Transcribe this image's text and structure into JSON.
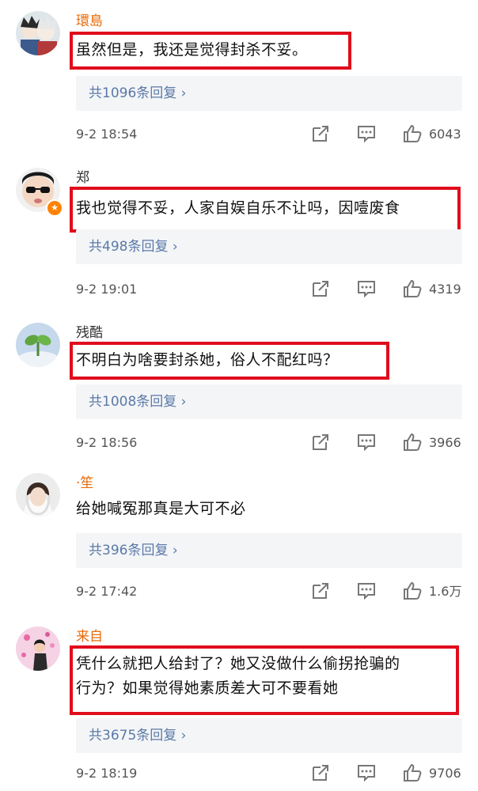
{
  "comments": [
    {
      "username": "環島",
      "text_lines": [
        "虽然但是，我还是觉得封杀不妥。"
      ],
      "replies": "共1096条回复 ›",
      "time": "9-2 18:54",
      "likes": "6043"
    },
    {
      "username": "郑",
      "text_lines": [
        "我也觉得不妥，人家自娱自乐不让吗，因噎废食"
      ],
      "replies": "共498条回复 ›",
      "time": "9-2 19:01",
      "likes": "4319"
    },
    {
      "username": "残酷",
      "text_lines": [
        "不明白为啥要封杀她，俗人不配红吗？"
      ],
      "replies": "共1008条回复 ›",
      "time": "9-2 18:56",
      "likes": "3966"
    },
    {
      "username": "·笙",
      "text_lines": [
        "给她喊冤那真是大可不必"
      ],
      "replies": "共396条回复 ›",
      "time": "9-2 17:42",
      "likes": "1.6万"
    },
    {
      "username": "来自",
      "text_lines": [
        "凭什么就把人给封了？她又没做什么偷拐抢骗的",
        "行为？如果觉得她素质差大可不要看她"
      ],
      "replies": "共3675条回复 ›",
      "time": "9-2 18:19",
      "likes": "9706"
    }
  ],
  "icons": {
    "share": "share-icon",
    "comment": "comment-icon",
    "like": "like-icon",
    "badge": "verified-badge-icon"
  },
  "colors": {
    "highlight": "#e00d1c",
    "username": "#e86b0a",
    "reply_link": "#5a79a8"
  }
}
